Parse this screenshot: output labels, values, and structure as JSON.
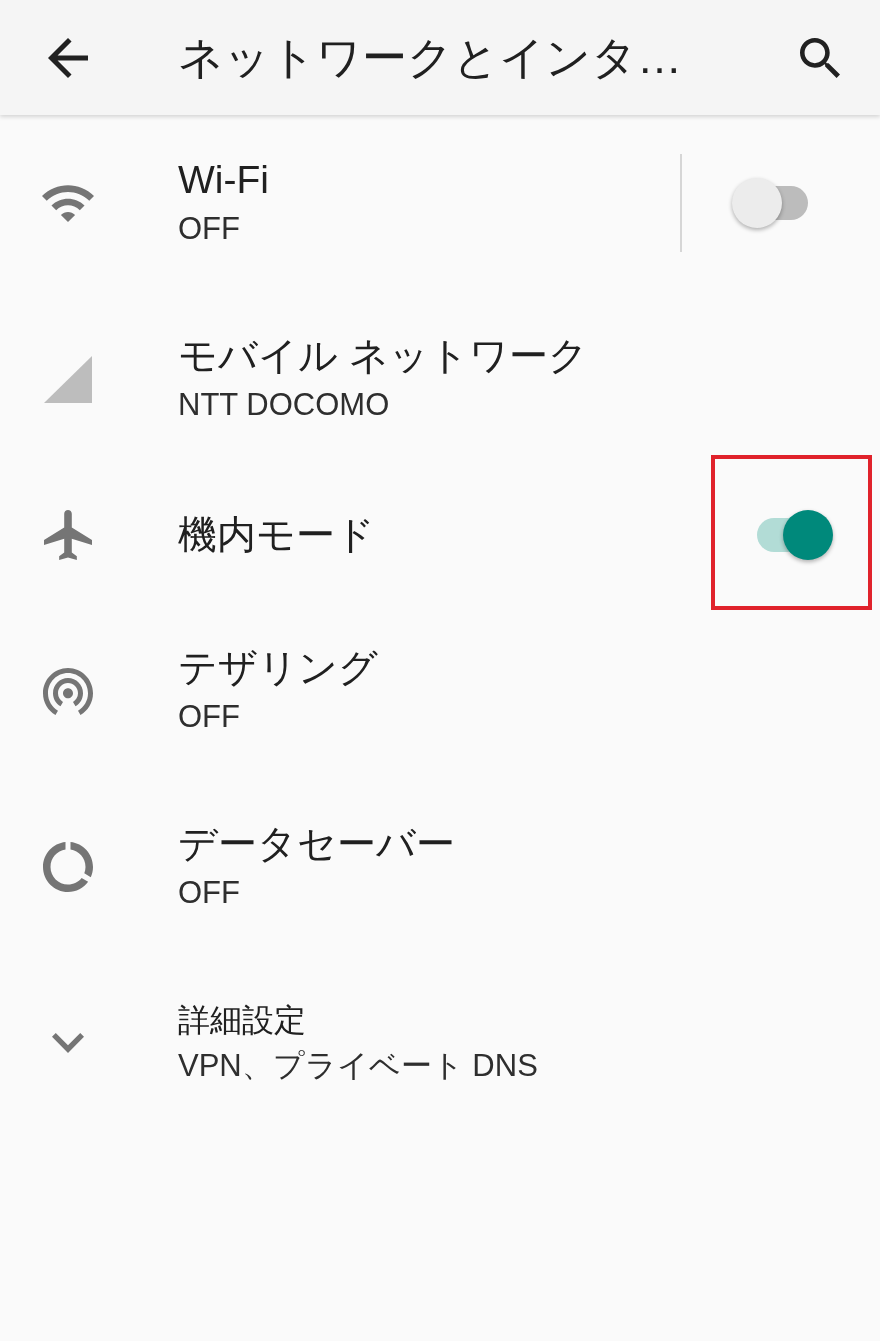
{
  "app_bar": {
    "title": "ネットワークとインタ…"
  },
  "rows": [
    {
      "kind": "split_switch",
      "title": "Wi-Fi",
      "subtitle": "OFF",
      "on": false,
      "highlighted": false
    },
    {
      "kind": "link",
      "title": "モバイル ネットワーク",
      "subtitle": "NTT DOCOMO",
      "highlighted": false
    },
    {
      "kind": "switch",
      "title": "機内モード",
      "on": true,
      "highlighted": true
    },
    {
      "kind": "link",
      "title": "テザリング",
      "subtitle": "OFF",
      "highlighted": false
    },
    {
      "kind": "link",
      "title": "データセーバー",
      "subtitle": "OFF",
      "highlighted": false
    },
    {
      "kind": "expand",
      "title": "詳細設定",
      "subtitle": "VPN、プライベート DNS",
      "highlighted": false
    }
  ]
}
